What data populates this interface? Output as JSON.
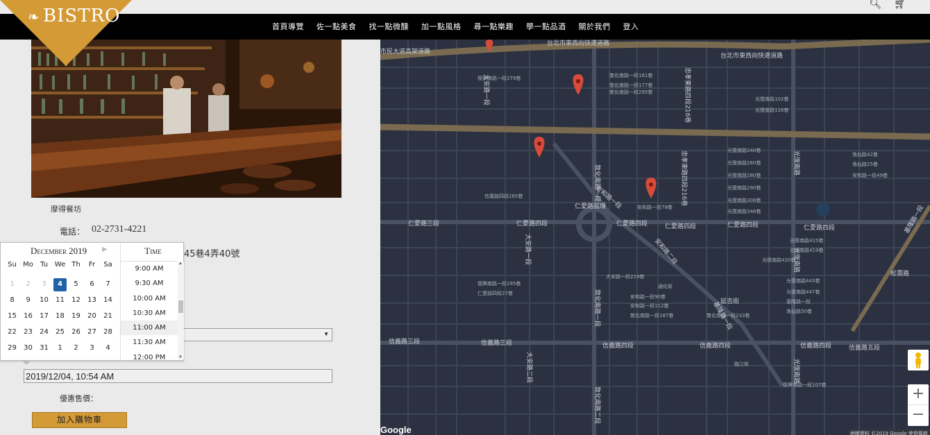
{
  "brand": {
    "logo_text": "BISTRO",
    "accent": "#d49a35"
  },
  "top_icons": [
    "search-icon",
    "cart-icon"
  ],
  "nav": {
    "items": [
      "首頁導覽",
      "佐一點美食",
      "找一點微醺",
      "加一點風格",
      "尋一點樂趣",
      "學一點品酒",
      "關於我們",
      "登入"
    ]
  },
  "restaurant": {
    "name": "摩得餐坊",
    "phone_label": "電話：",
    "phone": "02-2731-4221",
    "address_fragment": "45巷4弄40號"
  },
  "datepicker": {
    "month_label": "December 2019",
    "next": "▶",
    "weekdays": [
      "Su",
      "Mo",
      "Tu",
      "We",
      "Th",
      "Fr",
      "Sa"
    ],
    "days": [
      [
        "1",
        "2",
        "3",
        "4",
        "5",
        "6",
        "7"
      ],
      [
        "8",
        "9",
        "10",
        "11",
        "12",
        "13",
        "14"
      ],
      [
        "15",
        "16",
        "17",
        "18",
        "19",
        "20",
        "21"
      ],
      [
        "22",
        "23",
        "24",
        "25",
        "26",
        "27",
        "28"
      ],
      [
        "29",
        "30",
        "31",
        "1",
        "2",
        "3",
        "4"
      ]
    ],
    "selected_day": "4",
    "time_label": "Time",
    "times": [
      "9:00 AM",
      "9:30 AM",
      "10:00 AM",
      "10:30 AM",
      "11:00 AM",
      "11:30 AM",
      "12:00 PM"
    ],
    "hover_time": "11:00 AM"
  },
  "form": {
    "select_arrow": "▼",
    "datetime_value": "2019/12/04, 10:54 AM",
    "promo_label": "優惠售價：",
    "add_to_cart": "加入購物車"
  },
  "map": {
    "roads": {
      "highway": "台北市東西向快速道路",
      "highway_left": "市民大道高架道路",
      "ren_ai_3": "仁愛路三段",
      "ren_ai_4": "仁愛路四段",
      "xinyi_3": "信義路三段",
      "xinyi_4": "信義路四段",
      "xinyi_5": "信義路五段",
      "dunhua_s1": "敦化南路一段",
      "dunhua_s2": "敦化南路二段",
      "anhe_1": "安和路一段",
      "anhe_2": "安和路二段",
      "guangfu_s": "光復南路",
      "zhongxiao_e4": "忠孝東路四段216巷",
      "keelung_1": "基隆路一段",
      "daan_1": "大安路一段",
      "daan_2": "大安路二段",
      "yanji": "延吉街",
      "songshou": "松壽路",
      "ren_ai_circle": "仁愛路圓環",
      "lane_70": "仁愛路四段"
    },
    "labels": [
      "光復南路240巷",
      "光復南路260巷",
      "光復南路280巷",
      "光復南路290巷",
      "光復南路308巷",
      "光復南路346巷",
      "光復南路102巷",
      "光復南路116巷",
      "光復南路415巷",
      "光復南路419巷",
      "光復南路420巷",
      "光復南路443巷",
      "光復南路447巷",
      "基隆路一段",
      "逸仙路50巷",
      "逸仙路42巷",
      "逸仙路25巷",
      "安和路一段49巷",
      "安和路一段78巷",
      "安和路一段90巷",
      "安和路一段112巷",
      "敦化南路一段187巷",
      "敦化南路一段161巷",
      "敦化南路一段177巷",
      "敦化南路一段295巷",
      "大安路一段219巷",
      "信義路四段265巷",
      "敦化南路一段233巷",
      "通化街",
      "臨江街",
      "復興南路一段107巷",
      "復興南路一段279巷",
      "復興南路一段295巷",
      "仁愛路四段27巷"
    ],
    "google_logo": "Google",
    "attribution": "地圖資料 ©2019 Google 使用條款"
  }
}
